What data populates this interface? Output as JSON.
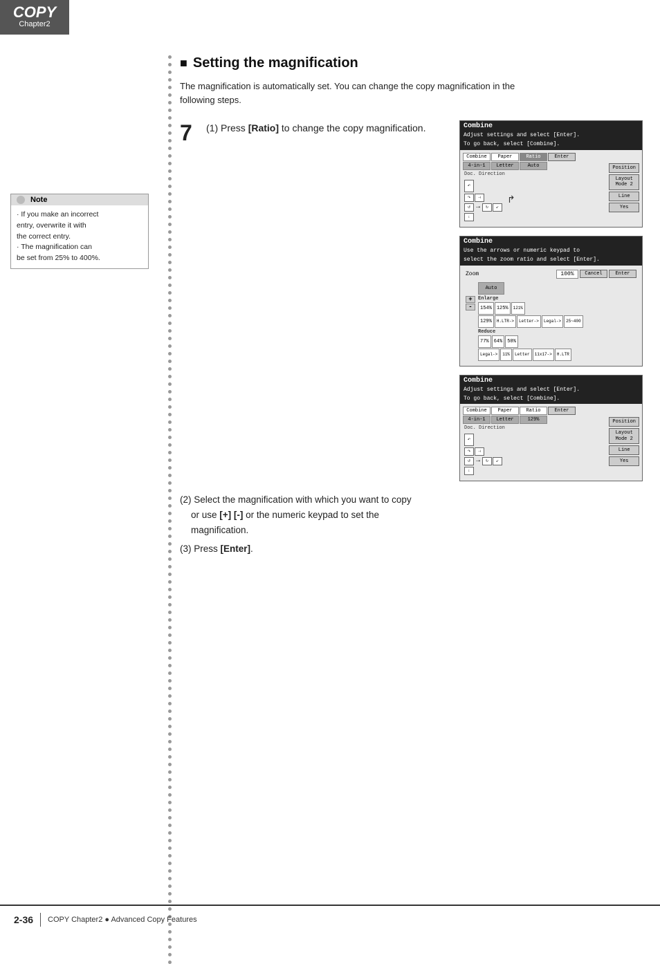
{
  "header": {
    "copy_label": "COPY",
    "chapter_label": "Chapter2"
  },
  "page": {
    "number": "2-36",
    "footer_text": "COPY Chapter2 ● Advanced Copy Features"
  },
  "section": {
    "title": "Setting the magnification",
    "description_line1": "The magnification is automatically set. You can change the copy magnification in the",
    "description_line2": "following steps."
  },
  "step1": {
    "number": "7",
    "text_before": "(1) Press ",
    "bold": "[Ratio]",
    "text_after": " to change the copy magnification."
  },
  "steps_lower": {
    "step2_before": "(2) Select the magnification with which you want to copy or use ",
    "step2_bold1": "[+] [-]",
    "step2_mid": " or the numeric keypad to set the magnification.",
    "step3_before": "(3) Press ",
    "step3_bold": "[Enter]",
    "step3_after": "."
  },
  "note": {
    "header": "Note",
    "line1": "· If you make an incorrect",
    "line2": "  entry, overwrite it with",
    "line3": "  the correct entry.",
    "line4": "· The  magnification  can",
    "line5": "  be set from 25% to 400%."
  },
  "screen1": {
    "title": "Combine",
    "sub1": "Adjust settings and select [Enter].",
    "sub2": "To go back, select [Combine].",
    "combine_label": "Combine",
    "combine_val": "4-in-1",
    "paper_label": "Paper",
    "paper_val": "Letter",
    "ratio_label": "Ratio",
    "ratio_val": "Auto",
    "enter_btn": "Enter",
    "doc_dir_label": "Doc. Direction",
    "position_btn": "Position",
    "layout_btn": "Layout\nMode 2",
    "line_label": "Line",
    "yes_btn": "Yes"
  },
  "screen2": {
    "title": "Combine",
    "sub1": "Use the arrows or numeric keypad to",
    "sub2": "select the zoom ratio and select [Enter].",
    "zoom_label": "Zoom",
    "zoom_val": "100%",
    "cancel_btn": "Cancel",
    "enter_btn": "Enter",
    "auto_btn": "Auto",
    "enlarge_label": "Enlarge",
    "e154": "154%",
    "e125": "125%",
    "e121": "121%",
    "e129": "129%",
    "e129b": "H.LTR->",
    "e125b": "Letter->",
    "e121b": "Legal->",
    "legal25": "25~400",
    "legal_b": "Legal",
    "x17": "x17",
    "x17b": "11x17",
    "reduce_label": "Reduce",
    "r77": "77%",
    "r64": "64%",
    "r50": "50%",
    "plus_btn": "+",
    "minus_btn": "-",
    "legal_arrow": "Legal->",
    "r11": "11%",
    "r11b": "11x17->",
    "letter_b": "Letter",
    "letter_bb": "Letter",
    "hlt": "H.LTR"
  },
  "screen3": {
    "title": "Combine",
    "sub1": "Adjust settings and select [Enter].",
    "sub2": "To go back, select [Combine].",
    "combine_label": "Combine",
    "combine_val": "4-in-1",
    "paper_label": "Paper",
    "paper_val": "Letter",
    "ratio_label": "Ratio",
    "ratio_val": "129%",
    "enter_btn": "Enter",
    "doc_dir_label": "Doc. Direction",
    "position_btn": "Position",
    "layout_btn": "Layout\nMode 2",
    "line_label": "Line",
    "yes_btn": "Yes"
  }
}
